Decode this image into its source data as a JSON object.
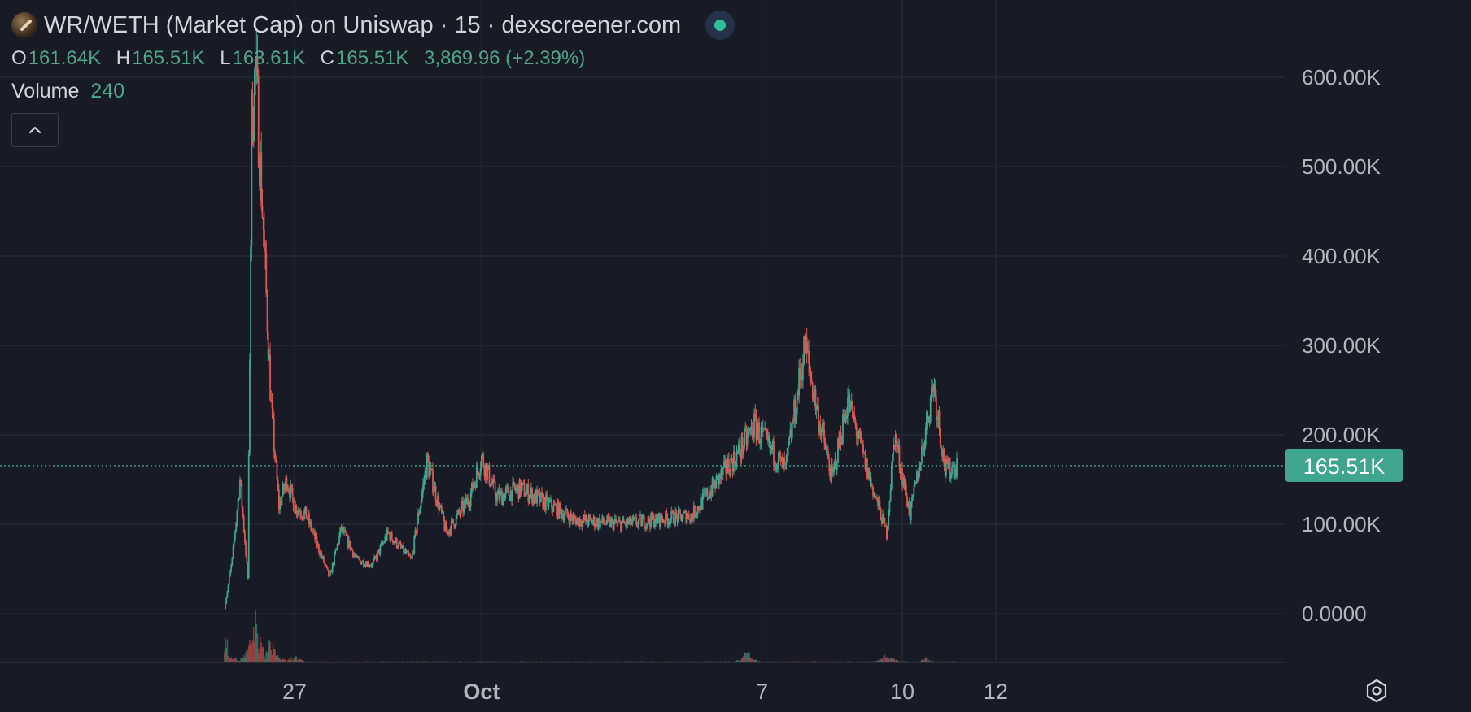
{
  "header": {
    "title": "WR/WETH (Market Cap) on Uniswap · 15 · dexscreener.com",
    "logo_icon": "token-logo-icon",
    "live_icon": "live-status-dot-icon"
  },
  "ohlc": {
    "o_label": "O",
    "o_value": "161.64K",
    "h_label": "H",
    "h_value": "165.51K",
    "l_label": "L",
    "l_value": "163.61K",
    "c_label": "C",
    "c_value": "165.51K",
    "change": "3,869.96 (+2.39%)"
  },
  "volume": {
    "label": "Volume",
    "value": "240",
    "collapse_icon": "chevron-up-icon"
  },
  "settings_icon": "gear-icon",
  "chart_data": {
    "type": "candlestick",
    "last_price_label": "165.51K",
    "last_price": 165510,
    "ylim": [
      0,
      600000
    ],
    "y_tick_labels": [
      "600.00K",
      "500.00K",
      "400.00K",
      "300.00K",
      "200.00K",
      "100.00K",
      "0.0000"
    ],
    "y_tick_values": [
      600000,
      500000,
      400000,
      300000,
      200000,
      100000,
      0
    ],
    "x_tick_labels": [
      "27",
      "Oct",
      "7",
      "10",
      "12"
    ],
    "x_tick_dates": [
      "Sep 27",
      "Oct 1",
      "Oct 7",
      "Oct 10",
      "Oct 12"
    ],
    "colors": {
      "up": "#3fa58f",
      "down": "#e0564f",
      "background": "#181a25",
      "grid": "#2b2e3a",
      "last_price": "#3fa58f"
    },
    "price_path": [
      {
        "date": "Sep 25 12:00",
        "price": 5000
      },
      {
        "date": "Sep 25 16:00",
        "price": 60000
      },
      {
        "date": "Sep 25 20:00",
        "price": 150000
      },
      {
        "date": "Sep 26 00:00",
        "price": 40000
      },
      {
        "date": "Sep 26 02:00",
        "price": 550000
      },
      {
        "date": "Sep 26 04:00",
        "price": 610000
      },
      {
        "date": "Sep 26 08:00",
        "price": 430000
      },
      {
        "date": "Sep 26 12:00",
        "price": 230000
      },
      {
        "date": "Sep 26 16:00",
        "price": 120000
      },
      {
        "date": "Sep 26 20:00",
        "price": 150000
      },
      {
        "date": "Sep 27 00:00",
        "price": 120000
      },
      {
        "date": "Sep 27 06:00",
        "price": 110000
      },
      {
        "date": "Sep 27 12:00",
        "price": 75000
      },
      {
        "date": "Sep 27 18:00",
        "price": 40000
      },
      {
        "date": "Sep 28 00:00",
        "price": 95000
      },
      {
        "date": "Sep 28 08:00",
        "price": 60000
      },
      {
        "date": "Sep 28 16:00",
        "price": 55000
      },
      {
        "date": "Sep 29 00:00",
        "price": 90000
      },
      {
        "date": "Sep 29 12:00",
        "price": 60000
      },
      {
        "date": "Sep 29 20:00",
        "price": 170000
      },
      {
        "date": "Sep 30 06:00",
        "price": 90000
      },
      {
        "date": "Sep 30 18:00",
        "price": 130000
      },
      {
        "date": "Oct 1 00:00",
        "price": 175000
      },
      {
        "date": "Oct 1 08:00",
        "price": 130000
      },
      {
        "date": "Oct 1 20:00",
        "price": 140000
      },
      {
        "date": "Oct 2 12:00",
        "price": 120000
      },
      {
        "date": "Oct 3 00:00",
        "price": 105000
      },
      {
        "date": "Oct 4 00:00",
        "price": 100000
      },
      {
        "date": "Oct 5 12:00",
        "price": 110000
      },
      {
        "date": "Oct 6 12:00",
        "price": 180000
      },
      {
        "date": "Oct 6 20:00",
        "price": 210000
      },
      {
        "date": "Oct 7 12:00",
        "price": 160000
      },
      {
        "date": "Oct 7 22:00",
        "price": 300000
      },
      {
        "date": "Oct 8 04:00",
        "price": 230000
      },
      {
        "date": "Oct 8 12:00",
        "price": 150000
      },
      {
        "date": "Oct 8 20:00",
        "price": 240000
      },
      {
        "date": "Oct 9 06:00",
        "price": 160000
      },
      {
        "date": "Oct 9 16:00",
        "price": 90000
      },
      {
        "date": "Oct 9 20:00",
        "price": 200000
      },
      {
        "date": "Oct 10 04:00",
        "price": 110000
      },
      {
        "date": "Oct 10 10:00",
        "price": 180000
      },
      {
        "date": "Oct 10 16:00",
        "price": 260000
      },
      {
        "date": "Oct 10 22:00",
        "price": 160000
      },
      {
        "date": "Oct 11 04:00",
        "price": 165510
      }
    ],
    "volume_peaks": [
      {
        "date": "Sep 25 12:00",
        "relative": 0.6
      },
      {
        "date": "Sep 26 04:00",
        "relative": 1.0
      },
      {
        "date": "Sep 26 12:00",
        "relative": 0.5
      },
      {
        "date": "Sep 27 00:00",
        "relative": 0.15
      },
      {
        "date": "Oct 6 16:00",
        "relative": 0.25
      },
      {
        "date": "Oct 9 16:00",
        "relative": 0.25
      },
      {
        "date": "Oct 10 12:00",
        "relative": 0.1
      }
    ]
  }
}
